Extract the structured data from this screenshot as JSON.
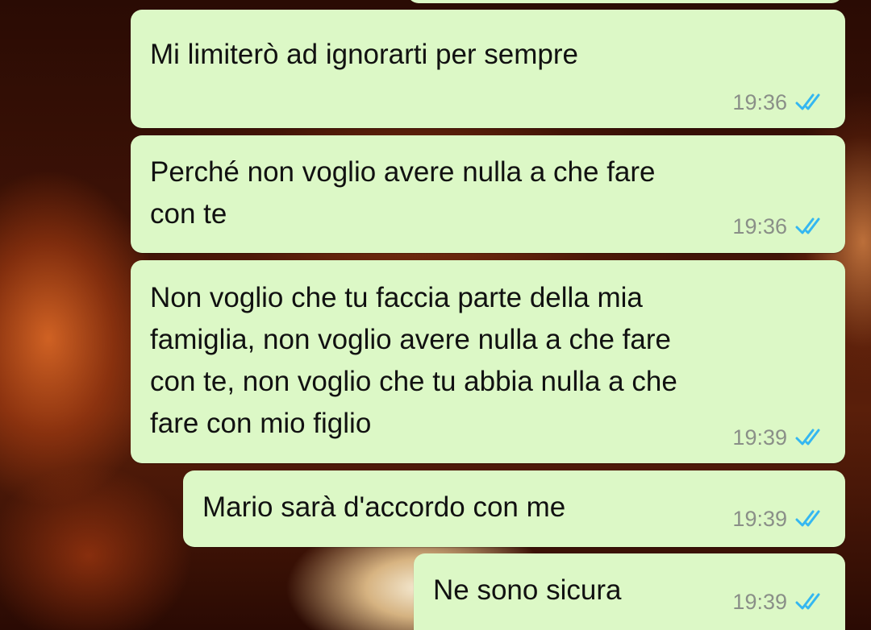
{
  "chat": {
    "messages": [
      {
        "text": "Mi limiterò ad ignorarti per sempre",
        "time": "19:36",
        "status_icon": "double-check-read-icon"
      },
      {
        "text": "Perché non voglio avere nulla a che fare\ncon te",
        "time": "19:36",
        "status_icon": "double-check-read-icon"
      },
      {
        "text": "Non voglio che tu faccia parte della mia\nfamiglia, non voglio avere nulla a che fare\ncon te, non voglio che tu abbia nulla a che\nfare con mio figlio",
        "time": "19:39",
        "status_icon": "double-check-read-icon"
      },
      {
        "text": "Mario sarà d'accordo con me",
        "time": "19:39",
        "status_icon": "double-check-read-icon"
      },
      {
        "text": "Ne sono sicura",
        "time": "19:39",
        "status_icon": "double-check-read-icon"
      }
    ]
  },
  "colors": {
    "outgoing_bubble": "#dcf8c6",
    "read_tick": "#34b7f1",
    "timestamp": "#8a8f88",
    "message_text": "#111111"
  }
}
